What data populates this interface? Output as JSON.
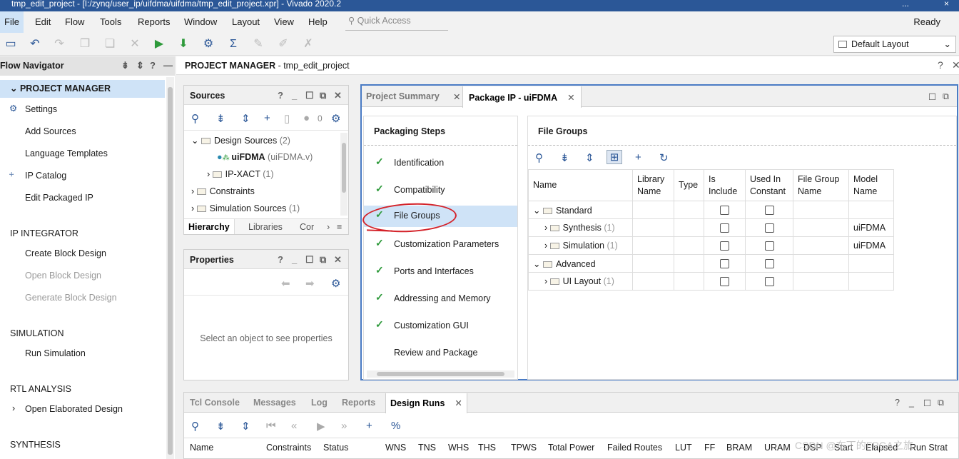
{
  "window": {
    "title": "tmp_edit_project - [I:/zynq/user_ip/uifdma/uifdma/tmp_edit_project.xpr] - Vivado 2020.2",
    "minimize": "...",
    "close": "×"
  },
  "menu": {
    "items": [
      "File",
      "Edit",
      "Flow",
      "Tools",
      "Reports",
      "Window",
      "Layout",
      "View",
      "Help"
    ],
    "quick_access_placeholder": "Quick Access",
    "status": "Ready"
  },
  "toolbar": {
    "layout_label": "Default Layout"
  },
  "flow_navigator": {
    "title": "Flow Navigator",
    "project_manager": "PROJECT MANAGER",
    "pm_items": [
      "Settings",
      "Add Sources",
      "Language Templates",
      "IP Catalog",
      "Edit Packaged IP"
    ],
    "ip_integrator": "IP INTEGRATOR",
    "ipi_items": [
      "Create Block Design",
      "Open Block Design",
      "Generate Block Design"
    ],
    "simulation": "SIMULATION",
    "sim_items": [
      "Run Simulation"
    ],
    "rtl": "RTL ANALYSIS",
    "rtl_items": [
      "Open Elaborated Design"
    ],
    "synthesis": "SYNTHESIS"
  },
  "pm_header": {
    "label": "PROJECT MANAGER",
    "project": " - tmp_edit_project"
  },
  "sources": {
    "title": "Sources",
    "badge_count": "0",
    "rows": [
      {
        "label": "Design Sources",
        "count": "(2)"
      },
      {
        "label": "uiFDMA",
        "count": "(uiFDMA.v)"
      },
      {
        "label": "IP-XACT",
        "count": "(1)"
      },
      {
        "label": "Constraints",
        "count": ""
      },
      {
        "label": "Simulation Sources",
        "count": "(1)"
      }
    ],
    "tabs": [
      "Hierarchy",
      "Libraries",
      "Cor"
    ]
  },
  "properties": {
    "title": "Properties",
    "empty_text": "Select an object to see properties"
  },
  "package_ip": {
    "tabs": [
      "Project Summary",
      "Package IP - uiFDMA"
    ],
    "steps_title": "Packaging Steps",
    "steps": [
      {
        "label": "Identification",
        "done": true
      },
      {
        "label": "Compatibility",
        "done": true
      },
      {
        "label": "File Groups",
        "done": true
      },
      {
        "label": "Customization Parameters",
        "done": true
      },
      {
        "label": "Ports and Interfaces",
        "done": true
      },
      {
        "label": "Addressing and Memory",
        "done": true
      },
      {
        "label": "Customization GUI",
        "done": true
      },
      {
        "label": "Review and Package",
        "done": false
      }
    ],
    "file_groups_title": "File Groups",
    "columns": [
      "Name",
      "Library Name",
      "Type",
      "Is Include",
      "Used In Constant",
      "File Group Name",
      "Model Name"
    ],
    "rows": [
      {
        "name": "Standard",
        "count": "",
        "model": "",
        "level": 0,
        "open": true
      },
      {
        "name": "Synthesis",
        "count": "(1)",
        "model": "uiFDMA",
        "level": 1,
        "open": false
      },
      {
        "name": "Simulation",
        "count": "(1)",
        "model": "uiFDMA",
        "level": 1,
        "open": false
      },
      {
        "name": "Advanced",
        "count": "",
        "model": "",
        "level": 0,
        "open": true
      },
      {
        "name": "UI Layout",
        "count": "(1)",
        "model": "",
        "level": 1,
        "open": false
      }
    ]
  },
  "bottom": {
    "tabs": [
      "Tcl Console",
      "Messages",
      "Log",
      "Reports",
      "Design Runs"
    ],
    "columns": [
      "Name",
      "Constraints",
      "Status",
      "WNS",
      "TNS",
      "WHS",
      "THS",
      "TPWS",
      "Total Power",
      "Failed Routes",
      "LUT",
      "FF",
      "BRAM",
      "URAM",
      "DSP",
      "Start",
      "Elapsed",
      "Run Strat"
    ]
  },
  "watermark": "CSDN @布丁的FPGA之旅",
  "colors": {
    "accent": "#2b5797",
    "selection": "#cfe3f7",
    "check": "#2e9a3b",
    "annotation": "#d4232a"
  }
}
